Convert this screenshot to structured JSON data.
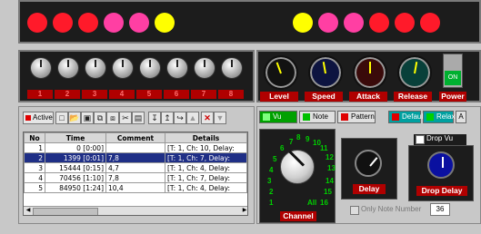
{
  "leds": [
    "#ff1a2a",
    "#ff1a2a",
    "#ff1a2a",
    "#ff3fa3",
    "#ff3fa3",
    "#ffff00",
    "#ffff00",
    "#ff3fa3",
    "#ff3fa3",
    "#ff1a2a",
    "#ff1a2a",
    "#ff1a2a"
  ],
  "channels": {
    "labels": [
      "1",
      "2",
      "3",
      "4",
      "5",
      "6",
      "7",
      "8"
    ]
  },
  "controls": [
    {
      "label": "Level",
      "color": "#121212"
    },
    {
      "label": "Speed",
      "color": "#0d1440"
    },
    {
      "label": "Attack",
      "color": "#3a0a0a"
    },
    {
      "label": "Release",
      "color": "#08403a"
    }
  ],
  "power": {
    "label": "Power",
    "button": "ON"
  },
  "toolbar": {
    "active_label": "Active"
  },
  "table": {
    "headers": [
      "No",
      "Time",
      "Comment",
      "Details"
    ],
    "rows": [
      [
        "1",
        "0 [0:00]",
        "",
        "[T: 1, Ch: 10, Delay:"
      ],
      [
        "2",
        "1399 [0:01]",
        "7,8",
        "[T: 1, Ch: 7, Delay:"
      ],
      [
        "3",
        "15444 [0:15]",
        "4,7",
        "[T: 1, Ch: 4, Delay:"
      ],
      [
        "4",
        "70456 [1:10]",
        "7,8",
        "[T: 1, Ch: 7, Delay:"
      ],
      [
        "5",
        "84950 [1:24]",
        "10,4",
        "[T: 1, Ch: 4, Delay:"
      ]
    ],
    "selected_row": 1
  },
  "tabs": {
    "vu": "Vu",
    "note": "Note",
    "pattern": "Pattern",
    "default": "Default",
    "relax": "Relax",
    "a": "A"
  },
  "dial": {
    "numbers": [
      "1",
      "2",
      "3",
      "4",
      "5",
      "6",
      "7",
      "8",
      "9",
      "10",
      "11",
      "12",
      "13",
      "14",
      "15",
      "16",
      "All"
    ],
    "label": "Channel"
  },
  "delay": {
    "label": "Delay"
  },
  "drop": {
    "checkbox": "Drop Vu",
    "label": "Drop Delay"
  },
  "only_note": {
    "label": "Only Note Number",
    "value": "36"
  }
}
